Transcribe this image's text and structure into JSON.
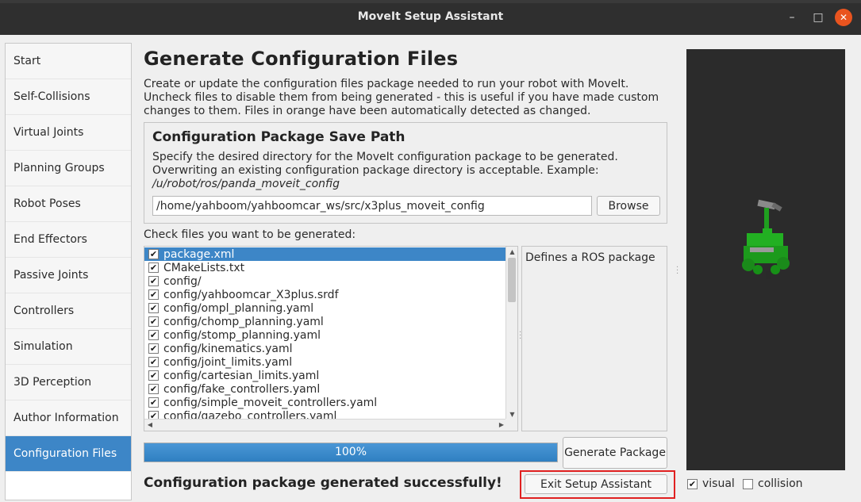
{
  "window": {
    "title": "MoveIt Setup Assistant",
    "controls": {
      "minimize": "–",
      "maximize": "□",
      "close": "✕"
    }
  },
  "sidebar": {
    "items": [
      {
        "label": "Start"
      },
      {
        "label": "Self-Collisions"
      },
      {
        "label": "Virtual Joints"
      },
      {
        "label": "Planning Groups"
      },
      {
        "label": "Robot Poses"
      },
      {
        "label": "End Effectors"
      },
      {
        "label": "Passive Joints"
      },
      {
        "label": "Controllers"
      },
      {
        "label": "Simulation"
      },
      {
        "label": "3D Perception"
      },
      {
        "label": "Author Information"
      },
      {
        "label": "Configuration Files",
        "active": true
      }
    ]
  },
  "page": {
    "title": "Generate Configuration Files",
    "description": "Create or update the configuration files package needed to run your robot with MoveIt. Uncheck files to disable them from being generated - this is useful if you have made custom changes to them. Files in orange have been automatically detected as changed."
  },
  "save_path": {
    "heading": "Configuration Package Save Path",
    "description_plain": "Specify the desired directory for the MoveIt configuration package to be generated. Overwriting an existing configuration package directory is acceptable. Example: ",
    "description_example": "/u/robot/ros/panda_moveit_config",
    "value": "/home/yahboom/yahboomcar_ws/src/x3plus_moveit_config",
    "browse_label": "Browse"
  },
  "files": {
    "label": "Check files you want to be generated:",
    "items": [
      {
        "name": "package.xml",
        "checked": true,
        "selected": true
      },
      {
        "name": "CMakeLists.txt",
        "checked": true
      },
      {
        "name": "config/",
        "checked": true
      },
      {
        "name": "config/yahboomcar_X3plus.srdf",
        "checked": true
      },
      {
        "name": "config/ompl_planning.yaml",
        "checked": true
      },
      {
        "name": "config/chomp_planning.yaml",
        "checked": true
      },
      {
        "name": "config/stomp_planning.yaml",
        "checked": true
      },
      {
        "name": "config/kinematics.yaml",
        "checked": true
      },
      {
        "name": "config/joint_limits.yaml",
        "checked": true
      },
      {
        "name": "config/cartesian_limits.yaml",
        "checked": true
      },
      {
        "name": "config/fake_controllers.yaml",
        "checked": true
      },
      {
        "name": "config/simple_moveit_controllers.yaml",
        "checked": true
      },
      {
        "name": "config/gazebo_controllers.yaml",
        "checked": true
      }
    ],
    "selected_description": "Defines a ROS package"
  },
  "progress": {
    "value": 100,
    "label": "100%"
  },
  "actions": {
    "generate_label": "Generate Package",
    "exit_label": "Exit Setup Assistant"
  },
  "status": {
    "message": "Configuration package generated successfully!"
  },
  "viewport": {
    "background": "#2b2b2b",
    "robot_color": "#22b022",
    "visual": {
      "label": "visual",
      "checked": true
    },
    "collision": {
      "label": "collision",
      "checked": false
    }
  },
  "colors": {
    "accent": "#3d86c7",
    "highlight": "#e02020"
  }
}
